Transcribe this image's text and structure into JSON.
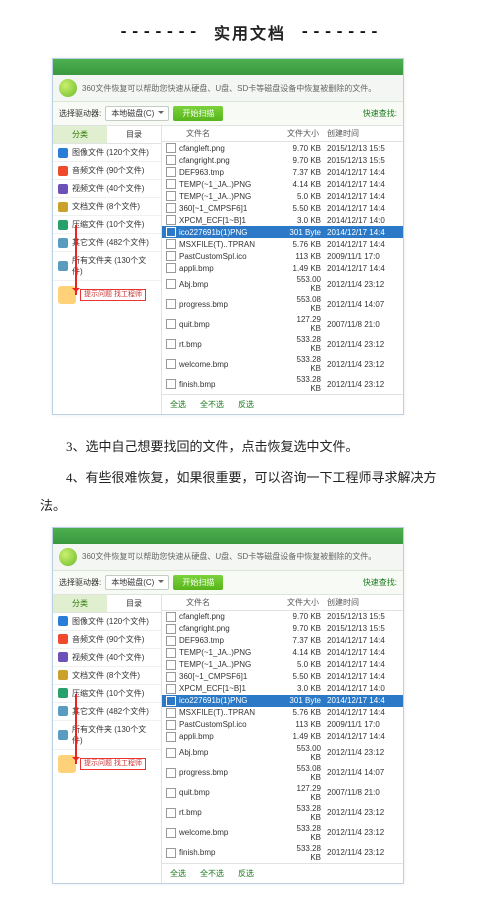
{
  "title_dash": "-------",
  "title": "实用文档",
  "text": {
    "p1": "3、选中自己想要找回的文件，点击恢复选中文件。",
    "p2": "4、有些很难恢复，如果很重要，可以咨询一下工程师寻求解决方法。"
  },
  "app": {
    "banner": "360文件恢复可以帮助您快速从硬盘、U盘、SD卡等磁盘设备中恢复被删除的文件。",
    "scan_label": "选择驱动器:",
    "drive": "本地磁盘(C)",
    "scan_btn": "开始扫描",
    "quick": "快速查找:",
    "tabs": [
      "分类",
      "目录"
    ],
    "side": [
      {
        "ico": "pic",
        "label": "图像文件 (120个文件)"
      },
      {
        "ico": "aud",
        "label": "音频文件 (90个文件)"
      },
      {
        "ico": "vid",
        "label": "视频文件 (40个文件)"
      },
      {
        "ico": "doc",
        "label": "文档文件 (8个文件)"
      },
      {
        "ico": "zip",
        "label": "压缩文件 (10个文件)"
      },
      {
        "ico": "all",
        "label": "其它文件 (482个文件)"
      },
      {
        "ico": "all",
        "label": "所有文件夹 (130个文件)"
      }
    ],
    "engineer": "提示问题\n找工程师",
    "cols": [
      "文件名",
      "文件大小",
      "创建时间"
    ],
    "rows": [
      {
        "n": "cfangleft.png",
        "s": "9.70 KB",
        "d": "2015/12/13 15:5"
      },
      {
        "n": "cfangright.png",
        "s": "9.70 KB",
        "d": "2015/12/13 15:5"
      },
      {
        "n": "DEF963.tmp",
        "s": "7.37 KB",
        "d": "2014/12/17 14:4"
      },
      {
        "n": "TEMP(~1_JA..)PNG",
        "s": "4.14 KB",
        "d": "2014/12/17 14:4"
      },
      {
        "n": "TEMP(~1_JA..)PNG",
        "s": "5.0 KB",
        "d": "2014/12/17 14:4"
      },
      {
        "n": "360[~1_CMPSF6]1",
        "s": "5.50 KB",
        "d": "2014/12/17 14:4"
      },
      {
        "n": "XPCM_ECF[1~B]1",
        "s": "3.0 KB",
        "d": "2014/12/17 14:0"
      },
      {
        "n": "ico227691b(1)PNG",
        "s": "301 Byte",
        "d": "2014/12/17 14:4",
        "sel": true
      },
      {
        "n": "MSXFILE(T)..TPRAN",
        "s": "5.76 KB",
        "d": "2014/12/17 14:4"
      },
      {
        "n": "PastCustomSpl.ico",
        "s": "113 KB",
        "d": "2009/11/1 17:0"
      },
      {
        "n": "appli.bmp",
        "s": "1.49 KB",
        "d": "2014/12/17 14:4"
      },
      {
        "n": "Abj.bmp",
        "s": "553.00 KB",
        "d": "2012/11/4 23:12"
      },
      {
        "n": "progress.bmp",
        "s": "553.08 KB",
        "d": "2012/11/4 14:07"
      },
      {
        "n": "quit.bmp",
        "s": "127.29 KB",
        "d": "2007/11/8 21:0"
      },
      {
        "n": "rt.bmp",
        "s": "533.28 KB",
        "d": "2012/11/4 23:12"
      },
      {
        "n": "welcome.bmp",
        "s": "533.28 KB",
        "d": "2012/11/4 23:12"
      },
      {
        "n": "finish.bmp",
        "s": "533.28 KB",
        "d": "2012/11/4 23:12"
      }
    ],
    "footer": [
      "全选",
      "全不选",
      "反选"
    ]
  }
}
